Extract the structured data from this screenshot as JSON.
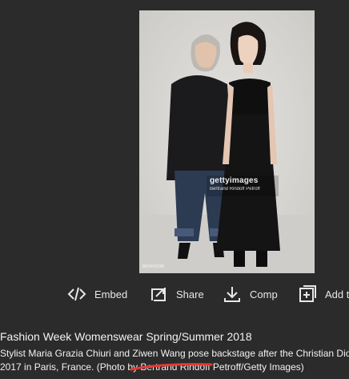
{
  "image": {
    "watermark_logo": "gettyimages",
    "watermark_credit": "Bertrand Rindoff Petroff",
    "corner_id": "865443180"
  },
  "actions": [
    {
      "label": "Embed",
      "icon": "code-icon"
    },
    {
      "label": "Share",
      "icon": "share-icon"
    },
    {
      "label": "Comp",
      "icon": "download-icon"
    },
    {
      "label": "Add to",
      "icon": "add-to-board-icon"
    }
  ],
  "caption": {
    "title": "Fashion Week Womenswear Spring/Summer 2018",
    "line1": "Stylist Maria Grazia Chiuri and Ziwen Wang pose backstage after the Christian Dior",
    "line2": "2017 in Paris, France. (Photo by Bertrand Rindoff Petroff/Getty Images)"
  },
  "colors": {
    "background": "#2b2b2b",
    "text": "#e6e6e6",
    "annotation_red": "#e53935"
  }
}
